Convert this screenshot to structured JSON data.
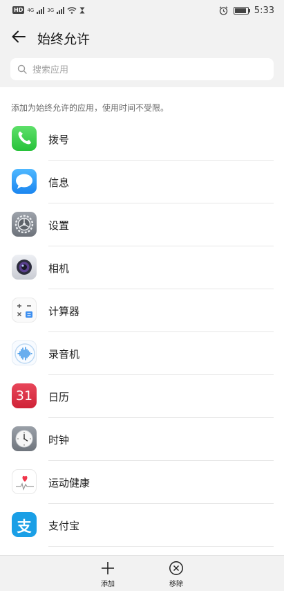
{
  "status_bar": {
    "hd": "HD",
    "sim1": "4G",
    "sim2": "3G",
    "time": "5:33"
  },
  "header": {
    "title": "始终允许",
    "back_icon": "arrow-left-icon"
  },
  "search": {
    "placeholder": "搜索应用",
    "value": ""
  },
  "description": "添加为始终允许的应用，使用时间不受限。",
  "apps": [
    {
      "label": "拨号",
      "icon": "phone-icon"
    },
    {
      "label": "信息",
      "icon": "message-icon"
    },
    {
      "label": "设置",
      "icon": "settings-icon"
    },
    {
      "label": "相机",
      "icon": "camera-icon"
    },
    {
      "label": "计算器",
      "icon": "calculator-icon"
    },
    {
      "label": "录音机",
      "icon": "recorder-icon"
    },
    {
      "label": "日历",
      "icon": "calendar-icon",
      "badge": "31"
    },
    {
      "label": "时钟",
      "icon": "clock-icon"
    },
    {
      "label": "运动健康",
      "icon": "health-icon"
    },
    {
      "label": "支付宝",
      "icon": "alipay-icon",
      "glyph": "支"
    }
  ],
  "bottom_bar": {
    "add_label": "添加",
    "remove_label": "移除"
  }
}
